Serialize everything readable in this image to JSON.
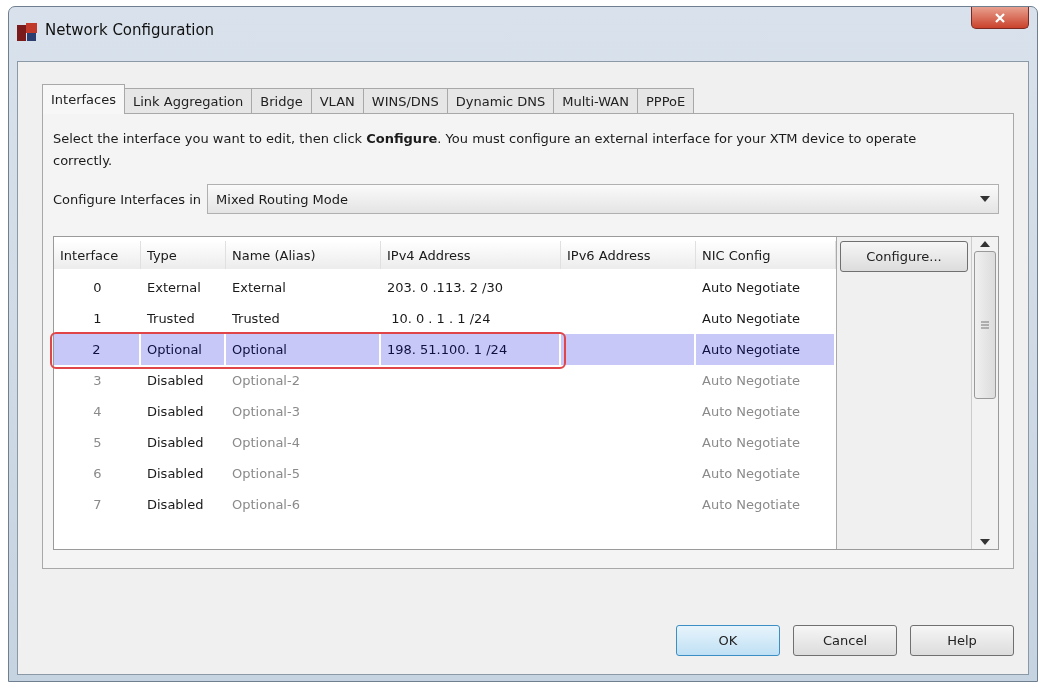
{
  "window": {
    "title": "Network Configuration"
  },
  "tabs": [
    {
      "label": "Interfaces",
      "selected": true
    },
    {
      "label": "Link Aggregation",
      "selected": false
    },
    {
      "label": "Bridge",
      "selected": false
    },
    {
      "label": "VLAN",
      "selected": false
    },
    {
      "label": "WINS/DNS",
      "selected": false
    },
    {
      "label": "Dynamic DNS",
      "selected": false
    },
    {
      "label": "Multi-WAN",
      "selected": false
    },
    {
      "label": "PPPoE",
      "selected": false
    }
  ],
  "description": "Select the interface you want to edit, then click **Configure**. You must configure an external interface for your XTM device to operate correctly.",
  "mode": {
    "label": "Configure Interfaces in",
    "value": "Mixed Routing Mode"
  },
  "table": {
    "columns": [
      "Interface",
      "Type",
      "Name (Alias)",
      "IPv4 Address",
      "IPv6 Address",
      "NIC Config"
    ],
    "rows": [
      {
        "cells": [
          "0",
          "External",
          "External",
          "203. 0 .113. 2 /30",
          "",
          "Auto Negotiate"
        ],
        "selected": false,
        "disabled": false,
        "annotated": false
      },
      {
        "cells": [
          "1",
          "Trusted",
          "Trusted",
          " 10. 0 . 1 . 1 /24",
          "",
          "Auto Negotiate"
        ],
        "selected": false,
        "disabled": false,
        "annotated": false
      },
      {
        "cells": [
          "2",
          "Optional",
          "Optional",
          "198. 51.100. 1 /24",
          "",
          "Auto Negotiate"
        ],
        "selected": true,
        "disabled": false,
        "annotated": true
      },
      {
        "cells": [
          "3",
          "Disabled",
          "Optional-2",
          "",
          "",
          "Auto Negotiate"
        ],
        "selected": false,
        "disabled": true,
        "annotated": false
      },
      {
        "cells": [
          "4",
          "Disabled",
          "Optional-3",
          "",
          "",
          "Auto Negotiate"
        ],
        "selected": false,
        "disabled": true,
        "annotated": false
      },
      {
        "cells": [
          "5",
          "Disabled",
          "Optional-4",
          "",
          "",
          "Auto Negotiate"
        ],
        "selected": false,
        "disabled": true,
        "annotated": false
      },
      {
        "cells": [
          "6",
          "Disabled",
          "Optional-5",
          "",
          "",
          "Auto Negotiate"
        ],
        "selected": false,
        "disabled": true,
        "annotated": false
      },
      {
        "cells": [
          "7",
          "Disabled",
          "Optional-6",
          "",
          "",
          "Auto Negotiate"
        ],
        "selected": false,
        "disabled": true,
        "annotated": false
      }
    ]
  },
  "side_button": "Configure...",
  "buttons": [
    {
      "label": "OK",
      "default": true
    },
    {
      "label": "Cancel",
      "default": false
    },
    {
      "label": "Help",
      "default": false
    }
  ]
}
